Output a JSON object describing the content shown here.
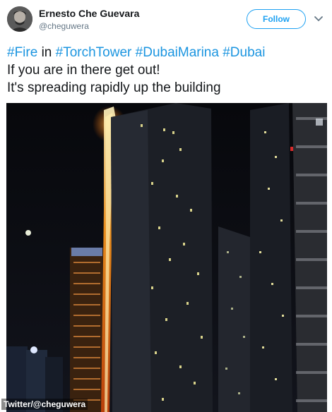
{
  "author": {
    "display_name": "Ernesto Che Guevara",
    "handle": "@cheguwera",
    "avatar_icon": "profile-photo"
  },
  "actions": {
    "follow_label": "Follow",
    "menu_icon": "chevron-down-icon"
  },
  "tweet": {
    "line1": {
      "tag1": "#Fire",
      "word1": " in ",
      "tag2": "#TorchTower",
      "space1": " ",
      "tag3": "#DubaiMarina",
      "space2": " ",
      "tag4": "#Dubai"
    },
    "line2": "If you are in there get out!",
    "line3": "It's spreading rapidly up the building"
  },
  "media": {
    "description_icon": "night-skyline-fire-photo",
    "watermark": "Twitter/@cheguwera"
  },
  "colors": {
    "accent": "#1da1f2",
    "hashtag": "#1b95e0",
    "text": "#14171a",
    "muted": "#657786"
  }
}
